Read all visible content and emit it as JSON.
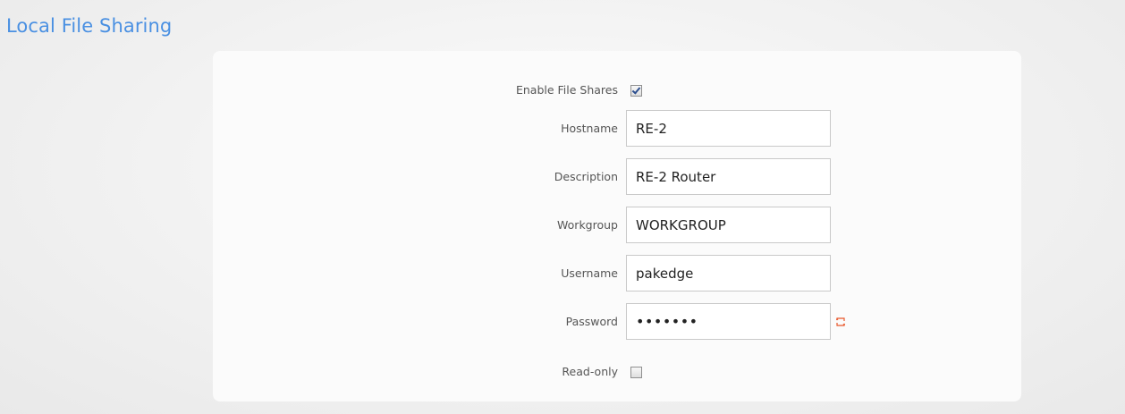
{
  "page": {
    "title": "Local File Sharing"
  },
  "form": {
    "enable_file_shares": {
      "label": "Enable File Shares",
      "checked": true
    },
    "hostname": {
      "label": "Hostname",
      "value": "RE-2"
    },
    "description": {
      "label": "Description",
      "value": "RE-2 Router"
    },
    "workgroup": {
      "label": "Workgroup",
      "value": "WORKGROUP"
    },
    "username": {
      "label": "Username",
      "value": "pakedge"
    },
    "password": {
      "label": "Password",
      "value": "•••••••"
    },
    "read_only": {
      "label": "Read-only",
      "checked": false
    }
  },
  "icons": {
    "password_toggle": "reveal-password-icon"
  },
  "colors": {
    "title": "#4a90e2",
    "reveal_icon": "#e8562a"
  }
}
